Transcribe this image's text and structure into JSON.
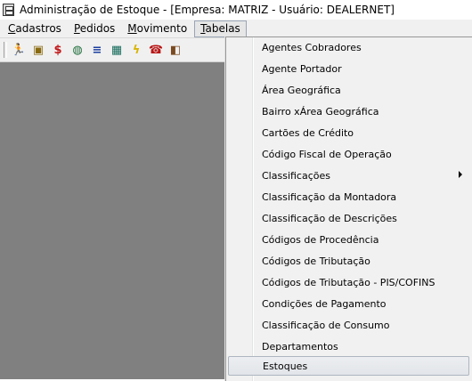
{
  "window": {
    "title": "Administração de Estoque - [Empresa: MATRIZ - Usuário: DEALERNET]"
  },
  "menubar": {
    "items": [
      {
        "underline": "C",
        "rest": "adastros"
      },
      {
        "underline": "P",
        "rest": "edidos"
      },
      {
        "underline": "M",
        "rest": "ovimento"
      },
      {
        "underline": "T",
        "rest": "abelas"
      }
    ]
  },
  "toolbar": {
    "buttons": [
      {
        "icon": "running-man-icon",
        "glyph": "🏃"
      },
      {
        "icon": "box-icon",
        "glyph": "▣"
      },
      {
        "icon": "dollar-arrows-icon",
        "glyph": "$"
      },
      {
        "icon": "globe-hand-icon",
        "glyph": "◍"
      },
      {
        "icon": "list-icon",
        "glyph": "≡"
      },
      {
        "icon": "calculator-icon",
        "glyph": "▦"
      },
      {
        "icon": "lightning-icon",
        "glyph": "ϟ"
      },
      {
        "icon": "telephone-icon",
        "glyph": "☎"
      },
      {
        "icon": "exit-door-icon",
        "glyph": "◧"
      }
    ]
  },
  "tabelas_menu": {
    "items": [
      {
        "label": "Agentes Cobradores"
      },
      {
        "label": "Agente Portador"
      },
      {
        "label": "Área Geográfica"
      },
      {
        "label": "Bairro xÁrea Geográfica"
      },
      {
        "label": "Cartões de Crédito"
      },
      {
        "label": "Código Fiscal de Operação"
      },
      {
        "label": "Classificações",
        "submenu": true
      },
      {
        "label": "Classificação da Montadora"
      },
      {
        "label": "Classificação de Descrições"
      },
      {
        "label": "Códigos de Procedência"
      },
      {
        "label": "Códigos de Tributação"
      },
      {
        "label": "Códigos de Tributação - PIS/COFINS"
      },
      {
        "label": "Condições de Pagamento"
      },
      {
        "label": "Classificação de Consumo"
      },
      {
        "label": "Departamentos"
      },
      {
        "label": "Estoques",
        "highlighted": true
      }
    ]
  },
  "colors": {
    "workspace": "#808080",
    "menu_background": "#f1f1f1",
    "highlight_border": "#aeb6c1"
  }
}
